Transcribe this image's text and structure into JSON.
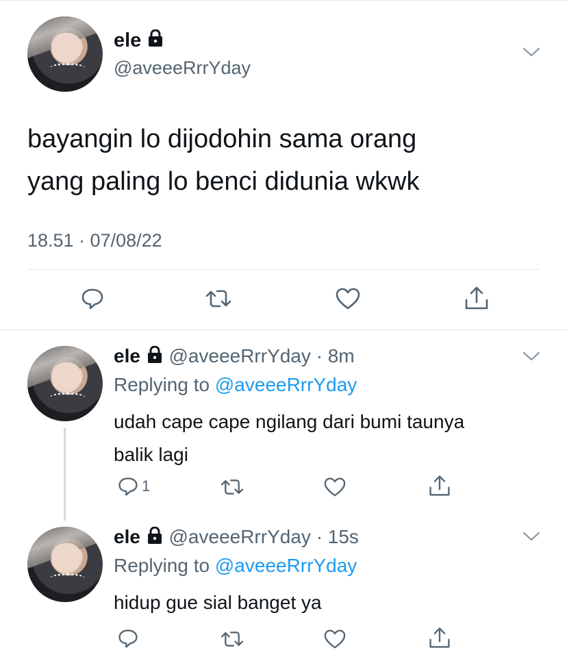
{
  "main_tweet": {
    "name": "ele",
    "handle": "@aveeeRrrYday",
    "text_line1": "bayangin lo dijodohin sama orang",
    "text_line2": "yang paling lo benci didunia wkwk",
    "timestamp": "18.51 · 07/08/22"
  },
  "replies": [
    {
      "name": "ele",
      "handle": "@aveeeRrrYday",
      "time": "· 8m",
      "replying_prefix": "Replying to ",
      "replying_to": "@aveeeRrrYday",
      "text_line1": "udah cape cape ngilang dari bumi taunya",
      "text_line2": "balik lagi",
      "reply_count": "1"
    },
    {
      "name": "ele",
      "handle": "@aveeeRrrYday",
      "time": "· 15s",
      "replying_prefix": "Replying to ",
      "replying_to": "@aveeeRrrYday",
      "text_line1": "hidup gue sial banget ya",
      "text_line2": "",
      "reply_count": ""
    }
  ],
  "icons": {
    "reply": "reply-icon",
    "retweet": "retweet-icon",
    "like": "heart-icon",
    "share": "share-icon",
    "more": "chevron-down-icon",
    "protected": "lock-icon"
  },
  "colors": {
    "text": "#0f1419",
    "muted": "#536471",
    "link": "#1d9bf0",
    "divider": "#e1e6ea"
  }
}
